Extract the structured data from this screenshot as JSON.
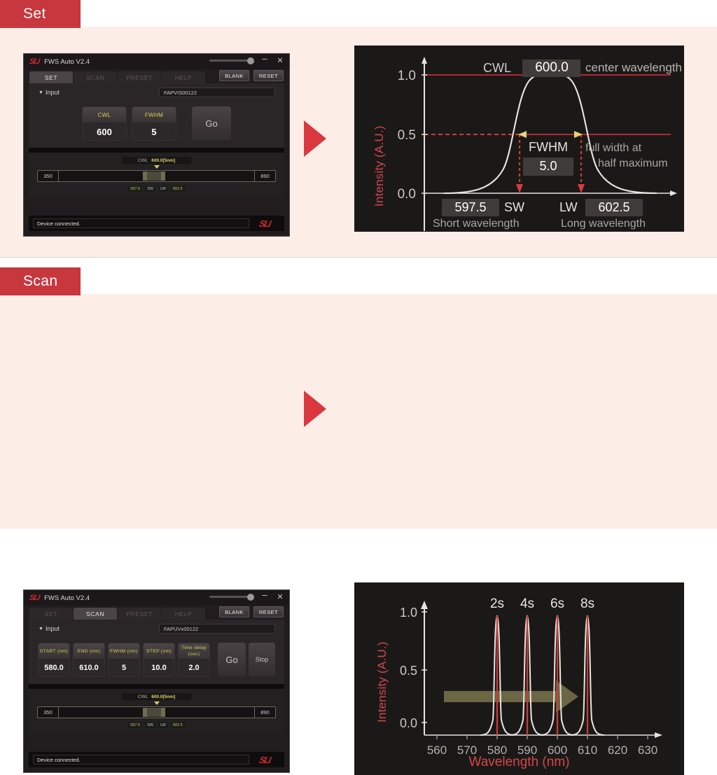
{
  "sections": [
    {
      "badge": "Set"
    },
    {
      "badge": "Scan"
    }
  ],
  "app": {
    "logo": "SLI",
    "title": "FWS Auto V2.4",
    "minimize_icon": "minimize-icon",
    "close_icon": "close-icon",
    "tabs": [
      "SET",
      "SCAN",
      "PRESET",
      "HELP"
    ],
    "header_buttons": [
      "BLANK",
      "RESET"
    ],
    "input_label": "Input",
    "status_text": "Device connected.",
    "slider": {
      "cwl_key": "CWL",
      "cwl_value": "600.0[5nm]",
      "min": "350",
      "max": "890",
      "sw_value": "597.5",
      "sw_label": "SW",
      "lw_label": "LW",
      "lw_value": "602.5"
    }
  },
  "set_window": {
    "device": "FAPVIS00122",
    "active_tab": "SET",
    "params": [
      {
        "label": "CWL",
        "value": "600"
      },
      {
        "label": "FWHM",
        "value": "5"
      }
    ],
    "go_label": "Go"
  },
  "scan_window": {
    "device": "FAPUVx00122",
    "active_tab": "SCAN",
    "params": [
      {
        "label": "START (nm)",
        "value": "580.0"
      },
      {
        "label": "END (nm)",
        "value": "610.0"
      },
      {
        "label": "FWHM (nm)",
        "value": "5"
      },
      {
        "label": "STEP (nm)",
        "value": "10.0"
      },
      {
        "label": "Time delay (sec)",
        "value": "2.0"
      }
    ],
    "go_label": "Go",
    "stop_label": "Stop"
  },
  "chart_data": [
    {
      "type": "line",
      "title": "",
      "ylabel": "Intensity (A.U.)",
      "xlabel": "",
      "yticks": [
        "1.0",
        "0.5",
        "0.0"
      ],
      "ylim": [
        0,
        1.08
      ],
      "annotations": {
        "cwl_key": "CWL",
        "cwl_value": "600.0",
        "cwl_desc": "center wavelength",
        "fwhm_key": "FWHM",
        "fwhm_value": "5.0",
        "fwhm_desc_line1": "full width at",
        "fwhm_desc_line2": "half maximum",
        "sw_value": "597.5",
        "sw_key": "SW",
        "sw_desc": "Short wavelength",
        "lw_key": "LW",
        "lw_value": "602.5",
        "lw_desc": "Long wavelength"
      },
      "peak_center": 600.0,
      "fwhm": 5.0,
      "half_max": 0.5,
      "max": 1.0
    },
    {
      "type": "line",
      "title": "",
      "ylabel": "Intensity (A.U.)",
      "xlabel": "Wavelength (nm)",
      "yticks": [
        "1.0",
        "0.5",
        "0.0"
      ],
      "ylim": [
        0,
        1.05
      ],
      "xticks": [
        "560",
        "570",
        "580",
        "590",
        "600",
        "610",
        "620",
        "630"
      ],
      "xlim": [
        560,
        630
      ],
      "peaks": [
        {
          "label": "2s",
          "center": 580,
          "height": 0.97
        },
        {
          "label": "4s",
          "center": 590,
          "height": 0.97
        },
        {
          "label": "6s",
          "center": 600,
          "height": 0.97
        },
        {
          "label": "8s",
          "center": 610,
          "height": 0.97
        }
      ],
      "fwhm": 5.0,
      "arrow_annotation": "scan-direction-arrow"
    }
  ],
  "colors": {
    "badge_red": "#c8373e",
    "accent_red": "#d2474b",
    "panel_bg": "#fceee7",
    "chart_bg": "#1b1918",
    "curve_white": "#e8e6e2",
    "marker_yellow": "#d2d44e"
  }
}
